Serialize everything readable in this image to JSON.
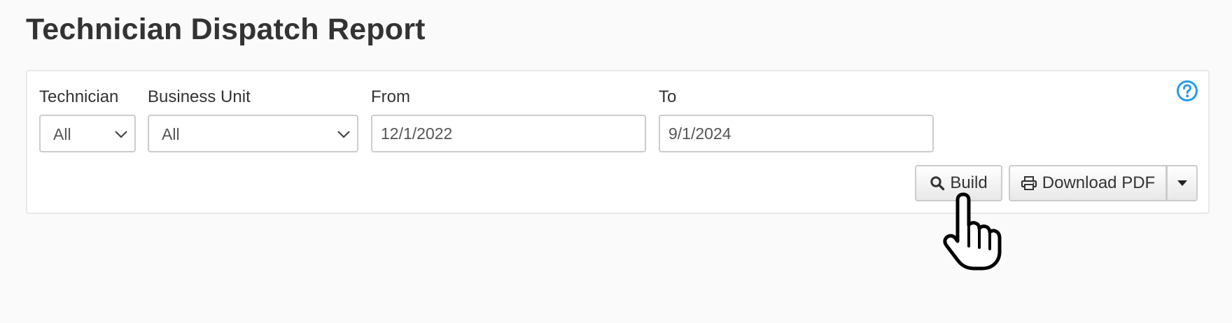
{
  "page": {
    "title": "Technician Dispatch Report"
  },
  "filters": {
    "technician": {
      "label": "Technician",
      "value": "All"
    },
    "business_unit": {
      "label": "Business Unit",
      "value": "All"
    },
    "from": {
      "label": "From",
      "value": "12/1/2022"
    },
    "to": {
      "label": "To",
      "value": "9/1/2024"
    }
  },
  "actions": {
    "build_label": "Build",
    "download_label": "Download PDF"
  },
  "icons": {
    "help": "question-circle-icon",
    "build": "search-icon",
    "download": "printer-icon",
    "dropdown": "caret-down-icon",
    "cursor": "hand-pointer-cursor"
  },
  "colors": {
    "accent": "#2a9be6",
    "page_bg": "#fafafa",
    "panel_bg": "#ffffff",
    "text": "#333333"
  }
}
